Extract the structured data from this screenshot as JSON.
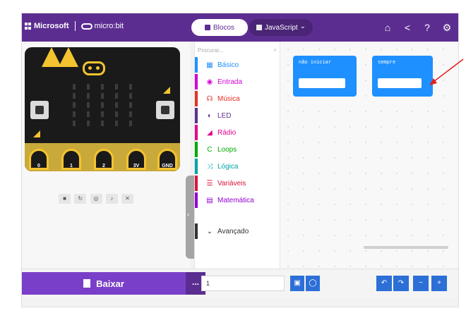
{
  "header": {
    "brand_ms": "Microsoft",
    "brand_mb": "micro:bit",
    "tab_blocks": "Blocos",
    "tab_js": "JavaScript",
    "icons": [
      "home-icon",
      "share-icon",
      "help-icon",
      "settings-icon"
    ]
  },
  "simulator": {
    "pins": [
      "0",
      "1",
      "2",
      "3V",
      "GND"
    ],
    "controls": [
      "stop",
      "restart",
      "slowmo",
      "mute",
      "fullscreen"
    ]
  },
  "toolbox": {
    "search_placeholder": "Procurar...",
    "categories": [
      {
        "label": "Básico",
        "icon": "grid-icon",
        "color": "#1e90ff"
      },
      {
        "label": "Entrada",
        "icon": "circle-dot-icon",
        "color": "#d400d4"
      },
      {
        "label": "Música",
        "icon": "headphones-icon",
        "color": "#e63022"
      },
      {
        "label": "LED",
        "icon": "toggle-icon",
        "color": "#5c2d91"
      },
      {
        "label": "Rádio",
        "icon": "signal-icon",
        "color": "#e3008c"
      },
      {
        "label": "Loops",
        "icon": "refresh-icon",
        "color": "#00aa00"
      },
      {
        "label": "Lógica",
        "icon": "shuffle-icon",
        "color": "#00a4a6"
      },
      {
        "label": "Variáveis",
        "icon": "list-icon",
        "color": "#dc143c"
      },
      {
        "label": "Matemática",
        "icon": "calculator-icon",
        "color": "#9400d3"
      }
    ],
    "advanced_label": "Avançado"
  },
  "workspace": {
    "block_on_start": "não iniciar",
    "block_forever": "sempre"
  },
  "bottom": {
    "download_label": "Baixar",
    "more_label": "...",
    "project_name": "1"
  },
  "colors": {
    "header": "#5c2d91",
    "download": "#7a3fc8",
    "block": "#1e90ff",
    "pointer": "#e02020"
  }
}
